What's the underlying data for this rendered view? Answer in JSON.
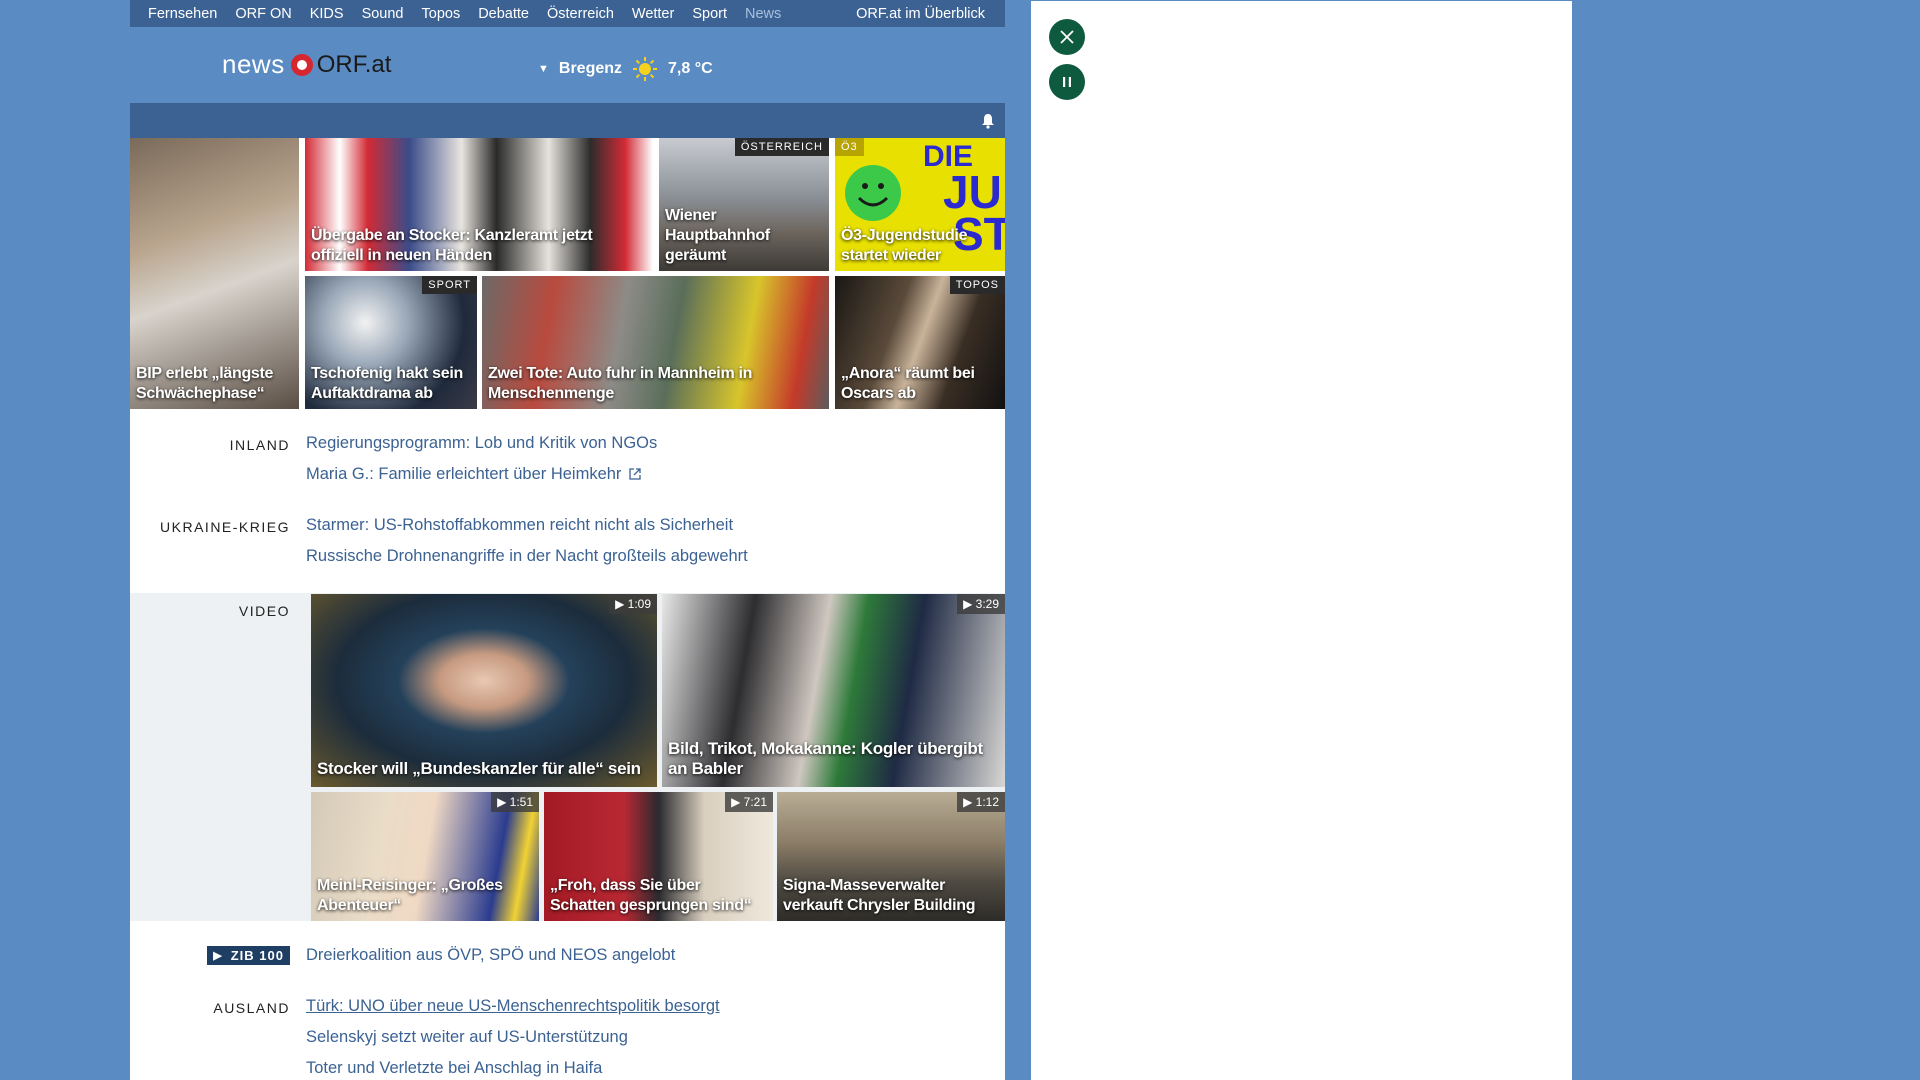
{
  "topnav": {
    "items": [
      "Fernsehen",
      "ORF ON",
      "KIDS",
      "Sound",
      "Topos",
      "Debatte",
      "Österreich",
      "Wetter",
      "Sport",
      "News"
    ],
    "right": "ORF.at im Überblick"
  },
  "header": {
    "logo_news": "news",
    "logo_orf": "ORF.at",
    "weather_location": "Bregenz",
    "weather_temp": "7,8 °C",
    "weather_icon": "sun-icon"
  },
  "tiles": [
    {
      "caption": "BIP erlebt „längste Schwächephase“",
      "tag": ""
    },
    {
      "caption": "Übergabe an Stocker: Kanzleramt jetzt offiziell in neuen Händen",
      "tag": ""
    },
    {
      "caption": "Wiener Hauptbahnhof geräumt",
      "tag": "ÖSTERREICH"
    },
    {
      "caption": "Ö3-Jugendstudie startet wieder",
      "tag": "Ö3"
    },
    {
      "caption": "Tschofenig hakt sein Auftaktdrama ab",
      "tag": "SPORT"
    },
    {
      "caption": "Zwei Tote: Auto fuhr in Mannheim in Menschenmenge",
      "tag": ""
    },
    {
      "caption": "„Anora“ räumt bei Oscars ab",
      "tag": "TOPOS"
    }
  ],
  "inland": {
    "label": "INLAND",
    "links": [
      "Regierungsprogramm: Lob und Kritik von NGOs",
      "Maria G.: Familie erleichtert über Heimkehr"
    ]
  },
  "ukraine": {
    "label": "UKRAINE-KRIEG",
    "links": [
      "Starmer: US-Rohstoffabkommen reicht nicht als Sicherheit",
      "Russische Drohnenangriffe in der Nacht großteils abgewehrt"
    ]
  },
  "video": {
    "label": "VIDEO",
    "items": [
      {
        "caption": "Stocker will „Bundeskanzler für alle“ sein",
        "duration": "1:09"
      },
      {
        "caption": "Bild, Trikot, Mokakanne: Kogler übergibt an Babler",
        "duration": "3:29"
      },
      {
        "caption": "Meinl-Reisinger: „Großes Abenteuer“",
        "duration": "1:51"
      },
      {
        "caption": "„Froh, dass Sie über Schatten gesprungen sind“",
        "duration": "7:21"
      },
      {
        "caption": "Signa-Masseverwalter verkauft Chrysler Building",
        "duration": "1:12"
      }
    ]
  },
  "zib": {
    "label_a": "ZIB",
    "label_b": "100",
    "link": "Dreierkoalition aus ÖVP, SPÖ und NEOS angelobt"
  },
  "ausland": {
    "label": "AUSLAND",
    "links": [
      "Türk: UNO über neue US-Menschenrechtspolitik besorgt",
      "Selenskyj setzt weiter auf US-Unterstützung",
      "Toter und Verletzte bei Anschlag in Haifa"
    ]
  },
  "overlay": {
    "close_icon": "close-icon",
    "pause_icon": "pause-icon"
  }
}
